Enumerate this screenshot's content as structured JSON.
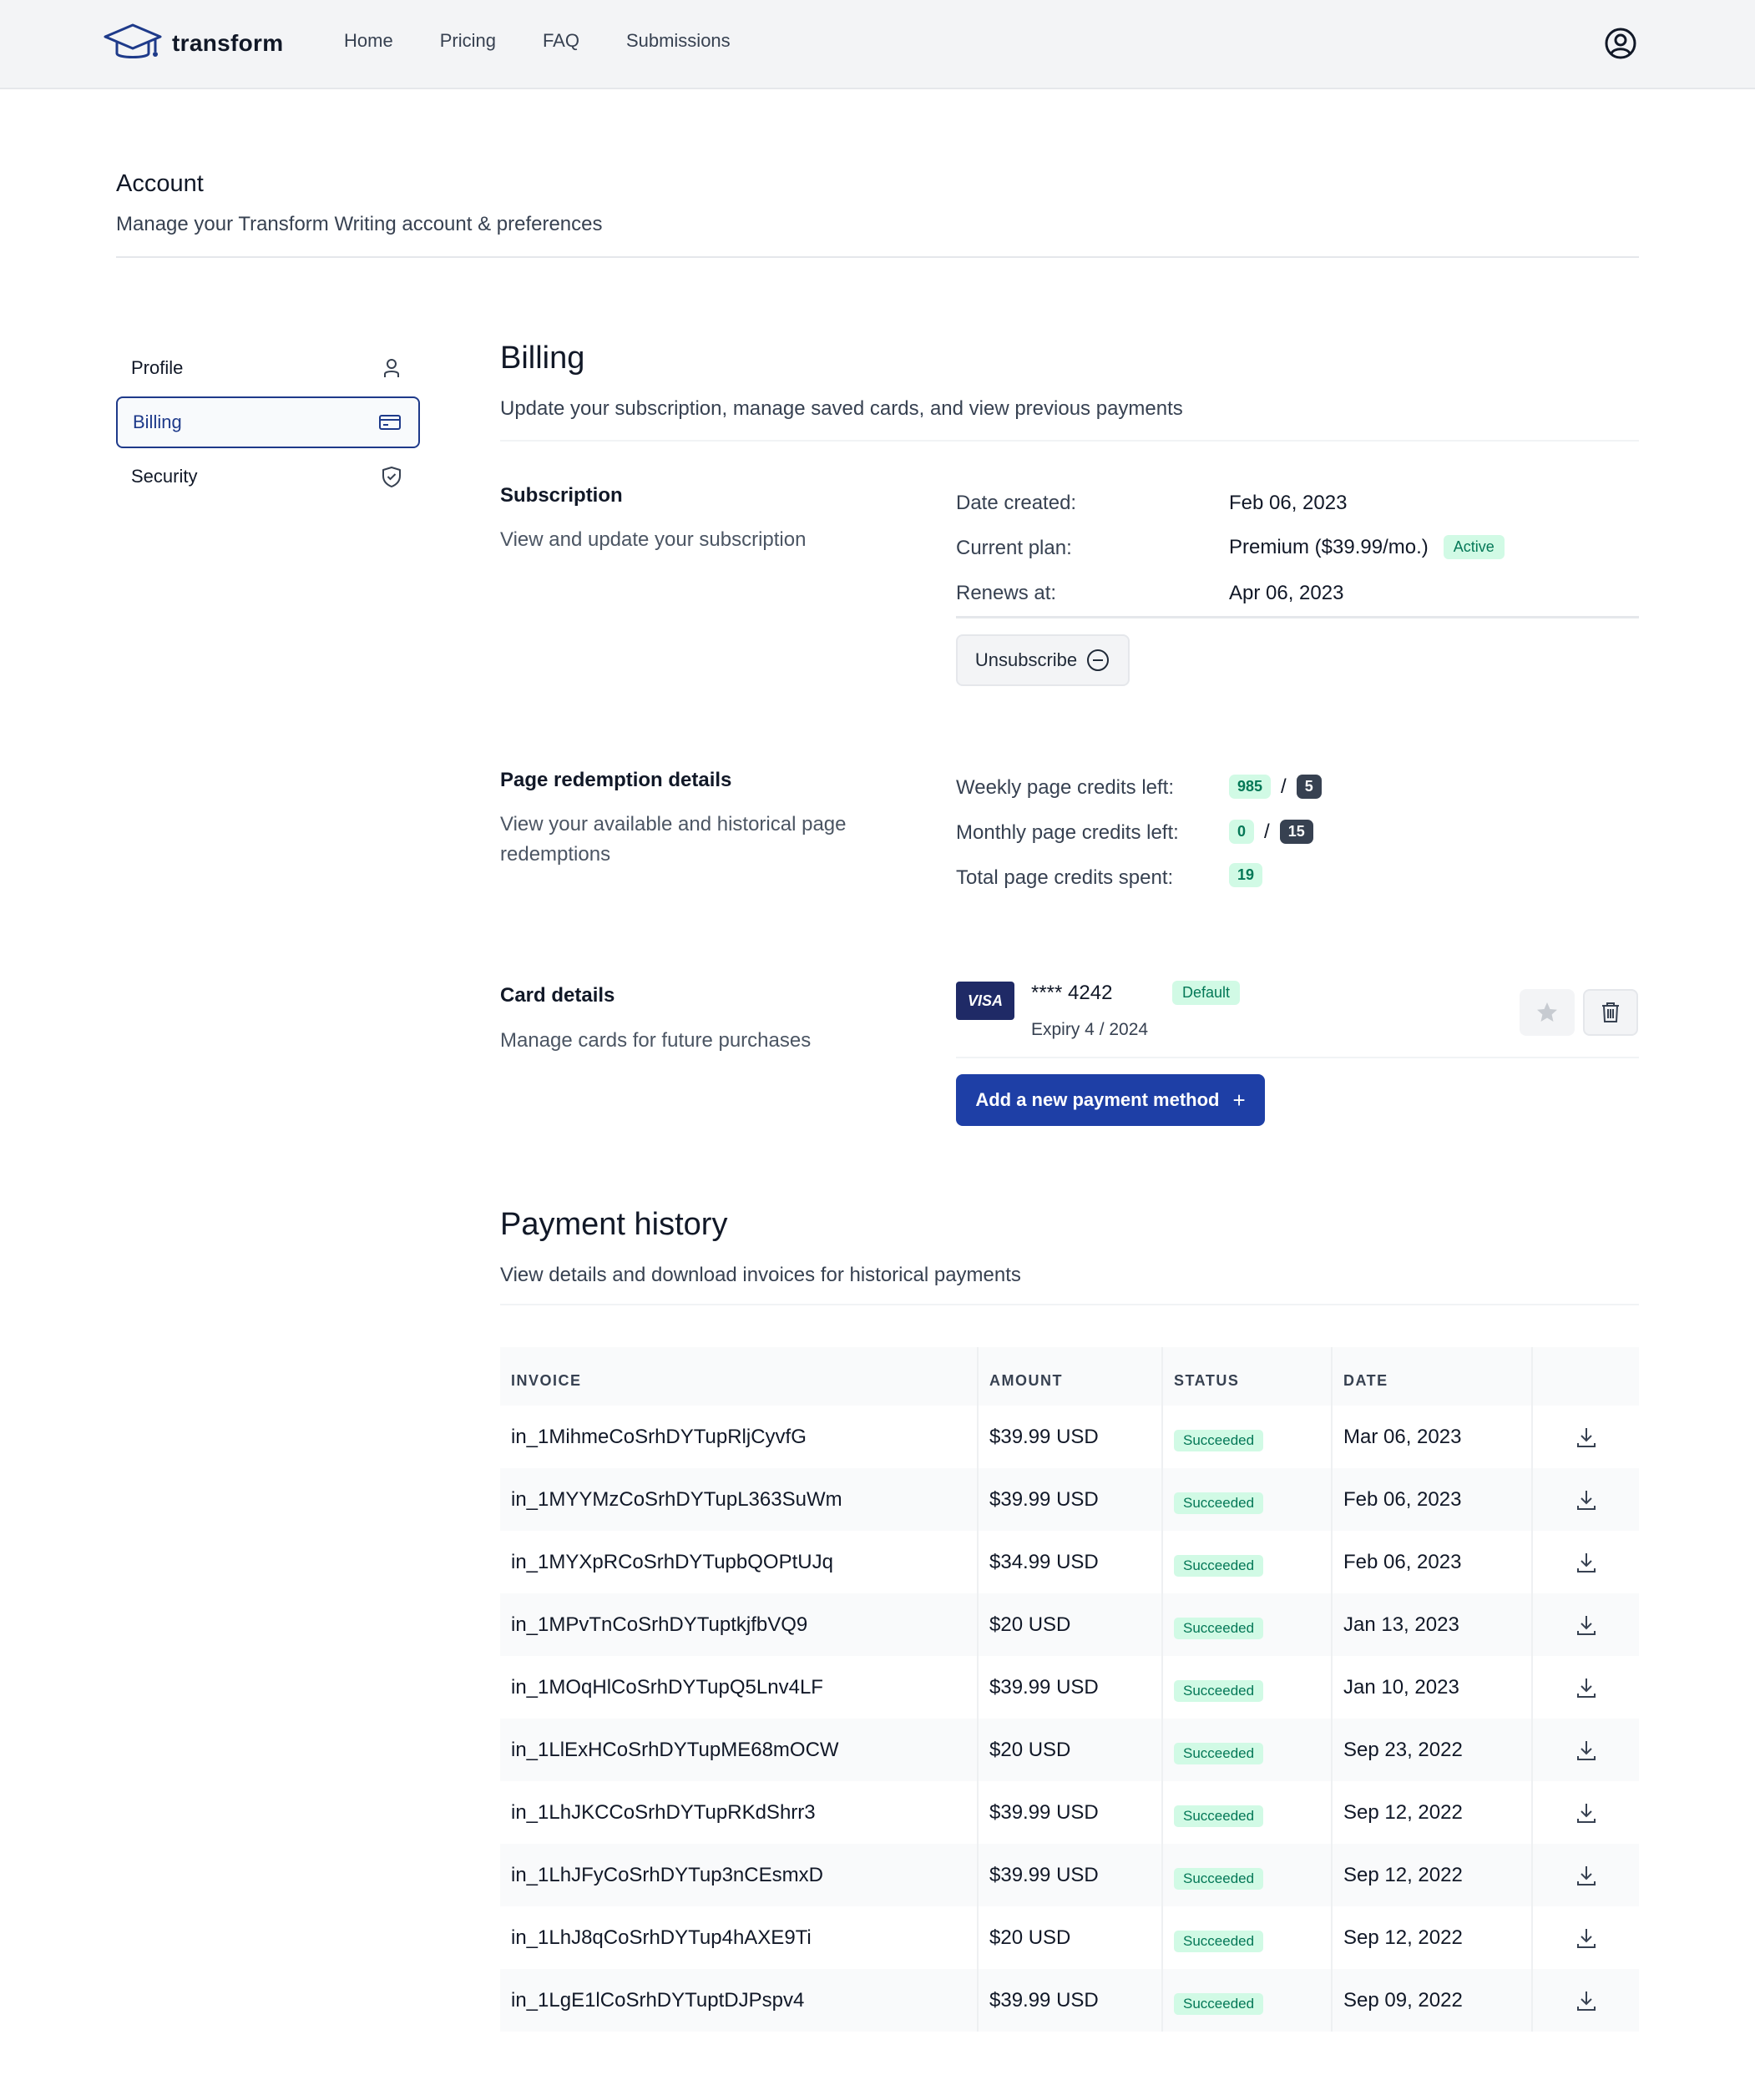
{
  "brand": {
    "name": "transform"
  },
  "nav": {
    "links": [
      "Home",
      "Pricing",
      "FAQ",
      "Submissions"
    ]
  },
  "account": {
    "title": "Account",
    "subtitle": "Manage your Transform Writing account & preferences"
  },
  "sidebar": {
    "items": [
      {
        "label": "Profile",
        "icon": "user-icon",
        "active": false
      },
      {
        "label": "Billing",
        "icon": "credit-card-icon",
        "active": true
      },
      {
        "label": "Security",
        "icon": "shield-check-icon",
        "active": false
      }
    ]
  },
  "billing": {
    "title": "Billing",
    "subtitle": "Update your subscription, manage saved cards, and view previous payments"
  },
  "subscription": {
    "title": "Subscription",
    "description": "View and update your subscription",
    "date_created_label": "Date created:",
    "date_created": "Feb 06, 2023",
    "current_plan_label": "Current plan:",
    "current_plan": "Premium ($39.99/mo.)",
    "status_badge": "Active",
    "renews_label": "Renews at:",
    "renews_at": "Apr 06, 2023",
    "unsubscribe_label": "Unsubscribe"
  },
  "redemption": {
    "title": "Page redemption details",
    "description": "View your available and historical page redemptions",
    "weekly_label": "Weekly page credits left:",
    "weekly_left": "985",
    "weekly_total": "5",
    "monthly_label": "Monthly page credits left:",
    "monthly_left": "0",
    "monthly_total": "15",
    "total_label": "Total page credits spent:",
    "total_spent": "19",
    "separator": "/"
  },
  "card": {
    "title": "Card details",
    "description": "Manage cards for future purchases",
    "brand": "VISA",
    "number": "**** 4242",
    "expiry": "Expiry 4 / 2024",
    "default_badge": "Default",
    "add_label": "Add a new payment method",
    "add_icon": "+"
  },
  "payments": {
    "title": "Payment history",
    "subtitle": "View details and download invoices for historical payments",
    "headers": [
      "INVOICE",
      "AMOUNT",
      "STATUS",
      "DATE"
    ],
    "rows": [
      {
        "invoice": "in_1MihmeCoSrhDYTupRljCyvfG",
        "amount": "$39.99 USD",
        "status": "Succeeded",
        "date": "Mar 06, 2023"
      },
      {
        "invoice": "in_1MYYMzCoSrhDYTupL363SuWm",
        "amount": "$39.99 USD",
        "status": "Succeeded",
        "date": "Feb 06, 2023"
      },
      {
        "invoice": "in_1MYXpRCoSrhDYTupbQOPtUJq",
        "amount": "$34.99 USD",
        "status": "Succeeded",
        "date": "Feb 06, 2023"
      },
      {
        "invoice": "in_1MPvTnCoSrhDYTuptkjfbVQ9",
        "amount": "$20 USD",
        "status": "Succeeded",
        "date": "Jan 13, 2023"
      },
      {
        "invoice": "in_1MOqHlCoSrhDYTupQ5Lnv4LF",
        "amount": "$39.99 USD",
        "status": "Succeeded",
        "date": "Jan 10, 2023"
      },
      {
        "invoice": "in_1LlExHCoSrhDYTupME68mOCW",
        "amount": "$20 USD",
        "status": "Succeeded",
        "date": "Sep 23, 2022"
      },
      {
        "invoice": "in_1LhJKCCoSrhDYTupRKdShrr3",
        "amount": "$39.99 USD",
        "status": "Succeeded",
        "date": "Sep 12, 2022"
      },
      {
        "invoice": "in_1LhJFyCoSrhDYTup3nCEsmxD",
        "amount": "$39.99 USD",
        "status": "Succeeded",
        "date": "Sep 12, 2022"
      },
      {
        "invoice": "in_1LhJ8qCoSrhDYTup4hAXE9Ti",
        "amount": "$20 USD",
        "status": "Succeeded",
        "date": "Sep 12, 2022"
      },
      {
        "invoice": "in_1LgE1lCoSrhDYTuptDJPspv4",
        "amount": "$39.99 USD",
        "status": "Succeeded",
        "date": "Sep 09, 2022"
      }
    ]
  },
  "colors": {
    "primary": "#1e3fa6",
    "active_nav": "#1e3a8a",
    "success_bg": "#d1fae5",
    "success_text": "#047857",
    "dark_badge": "#374151"
  }
}
